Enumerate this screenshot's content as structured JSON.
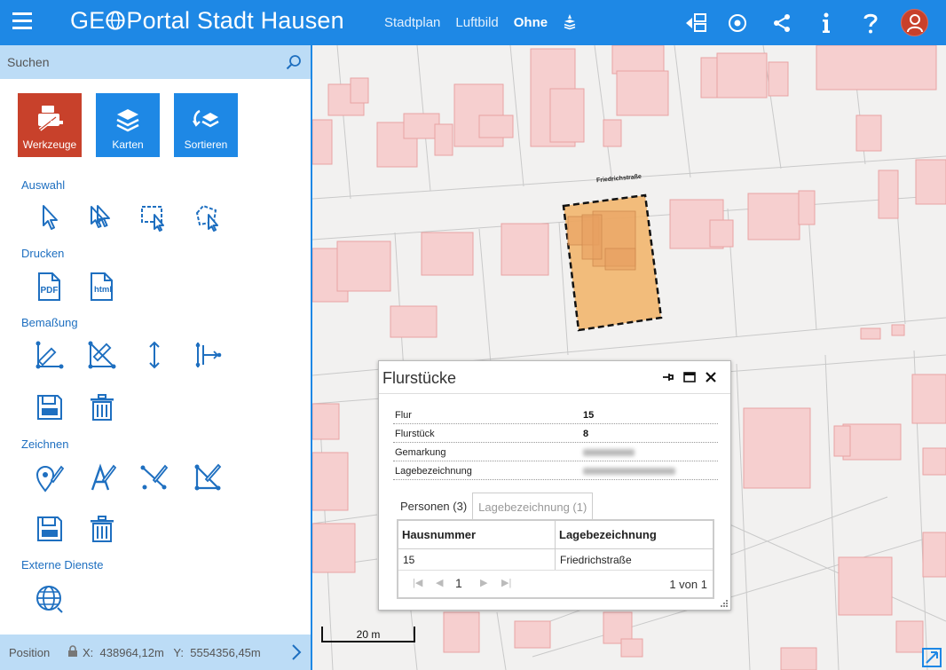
{
  "header": {
    "title_prefix": "GE",
    "title_rest": "Portal Stadt Hausen",
    "maptypes": [
      "Stadtplan",
      "Luftbild",
      "Ohne"
    ],
    "active_maptype": "Ohne"
  },
  "sidebar": {
    "search_placeholder": "Suchen",
    "big_buttons": [
      "Werkzeuge",
      "Karten",
      "Sortieren"
    ],
    "sections": {
      "auswahl": "Auswahl",
      "drucken": "Drucken",
      "bemassung": "Bemaßung",
      "zeichnen": "Zeichnen",
      "extern": "Externe Dienste"
    },
    "print_pdf": "PDF",
    "print_html": "html"
  },
  "position": {
    "label": "Position",
    "x_label": "X:",
    "x_value": "438964,12m",
    "y_label": "Y:",
    "y_value": "5554356,45m"
  },
  "map": {
    "street_label": "Friedrichstraße",
    "scale_label": "20 m"
  },
  "popup": {
    "title": "Flurstücke",
    "properties": [
      {
        "key": "Flur",
        "value": "15"
      },
      {
        "key": "Flurstück",
        "value": "8"
      },
      {
        "key": "Gemarkung",
        "value": ""
      },
      {
        "key": "Lagebezeichnung",
        "value": ""
      }
    ],
    "tabs": [
      "Personen (3)",
      "Lagebezeichnung (1)"
    ],
    "table": {
      "headers": [
        "Hausnummer",
        "Lagebezeichnung"
      ],
      "rows": [
        [
          "15",
          "Friedrichstraße"
        ]
      ]
    },
    "pager": {
      "page": "1",
      "count": "1 von 1"
    }
  },
  "colors": {
    "primary": "#1e88e5",
    "accent": "#c8412b",
    "panel_light": "#bcdcf6",
    "building": "#f6c6c6",
    "selection": "#f2b366"
  }
}
